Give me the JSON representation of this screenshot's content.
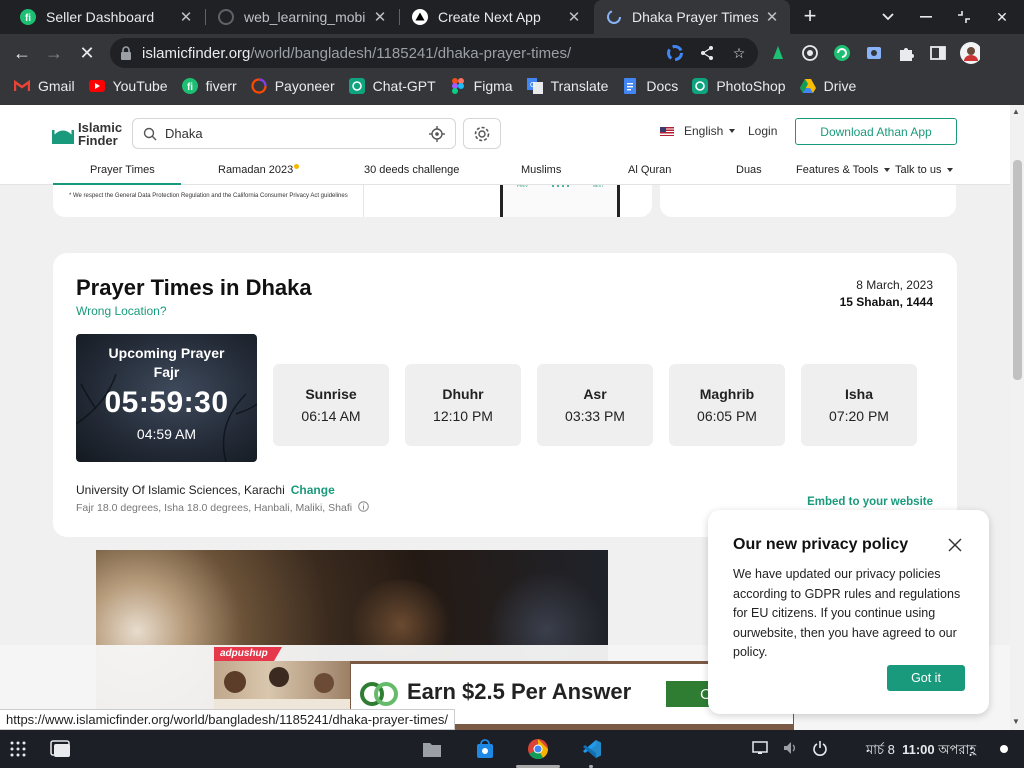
{
  "browser": {
    "tabs": [
      {
        "title": "Seller Dashboard",
        "icon": "fiverr-icon",
        "active": false
      },
      {
        "title": "web_learning_mobile",
        "icon": "github-icon",
        "active": false
      },
      {
        "title": "Create Next App",
        "icon": "vercel-icon",
        "active": false
      },
      {
        "title": "Dhaka Prayer Times",
        "icon": "loading-icon",
        "active": true
      }
    ],
    "url": {
      "domain": "islamicfinder.org",
      "path": "/world/bangladesh/1185241/dhaka-prayer-times/"
    },
    "bookmarks": [
      {
        "label": "Gmail",
        "icon": "gmail-icon",
        "color": "#ea4335"
      },
      {
        "label": "YouTube",
        "icon": "youtube-icon",
        "color": "#ff0000"
      },
      {
        "label": "fiverr",
        "icon": "fiverr-icon",
        "color": "#1dbf73"
      },
      {
        "label": "Payoneer",
        "icon": "payoneer-icon",
        "color": "#ff4800"
      },
      {
        "label": "Chat-GPT",
        "icon": "chatgpt-icon",
        "color": "#10a37f"
      },
      {
        "label": "Figma",
        "icon": "figma-icon",
        "color": "#a259ff"
      },
      {
        "label": "Translate",
        "icon": "translate-icon",
        "color": "#4285f4"
      },
      {
        "label": "Docs",
        "icon": "docs-icon",
        "color": "#4285f4"
      },
      {
        "label": "PhotoShop",
        "icon": "photoshop-icon",
        "color": "#31a8ff"
      },
      {
        "label": "Drive",
        "icon": "drive-icon",
        "color": "#fbbc04"
      }
    ]
  },
  "site": {
    "logo_line1": "Islamic",
    "logo_line2": "Finder",
    "search_value": "Dhaka",
    "language": "English",
    "login": "Login",
    "download_button": "Download Athan App",
    "accent_color": "#1a9a7c",
    "nav": [
      {
        "label": "Prayer Times",
        "active": true
      },
      {
        "label": "Ramadan 2023",
        "active": false
      },
      {
        "label": "30 deeds challenge",
        "active": false
      },
      {
        "label": "Muslims",
        "active": false
      },
      {
        "label": "Al Quran",
        "active": false
      },
      {
        "label": "Duas",
        "active": false
      },
      {
        "label": "Features & Tools",
        "active": false
      },
      {
        "label": "Talk to us",
        "active": false
      }
    ],
    "gdpr_note": "* We respect the General Data Protection Regulation and the California Consumer Privacy Act guidelines"
  },
  "prayer": {
    "title": "Prayer Times in Dhaka",
    "wrong_location": "Wrong Location?",
    "date": "8 March, 2023",
    "hijri_date": "15 Shaban, 1444",
    "upcoming_label": "Upcoming Prayer",
    "upcoming_name": "Fajr",
    "countdown": "05:59:30",
    "upcoming_time": "04:59 AM",
    "times": [
      {
        "name": "Sunrise",
        "time": "06:14 AM"
      },
      {
        "name": "Dhuhr",
        "time": "12:10 PM"
      },
      {
        "name": "Asr",
        "time": "03:33 PM"
      },
      {
        "name": "Maghrib",
        "time": "06:05 PM"
      },
      {
        "name": "Isha",
        "time": "07:20 PM"
      }
    ],
    "method": "University Of Islamic Sciences, Karachi",
    "change": "Change",
    "angles": "Fajr 18.0 degrees, Isha 18.0 degrees, Hanbali, Maliki, Shafi",
    "embed": "Embed to your website"
  },
  "privacy": {
    "title": "Our new privacy policy",
    "body": "We have updated our privacy policies according to GDPR rules and regulations for EU citizens. If you continue using ourwebsite, then you have agreed to our policy.",
    "button": "Got it"
  },
  "ad": {
    "label": "adpushup",
    "text": "Earn $2.5 Per Answer",
    "button": "Open"
  },
  "status_url": "https://www.islamicfinder.org/world/bangladesh/1185241/dhaka-prayer-times/",
  "taskbar": {
    "date": "মার্চ 8",
    "time": "11:00",
    "period": "অপরাহ্ণ"
  }
}
